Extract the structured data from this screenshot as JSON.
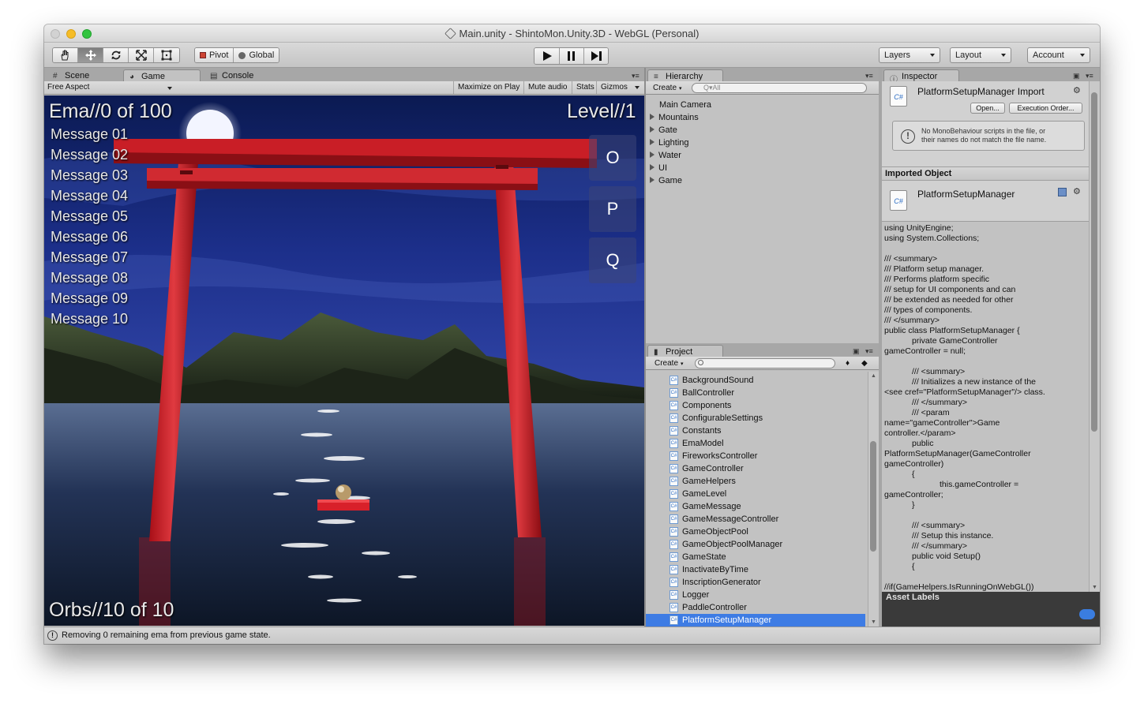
{
  "window": {
    "title": "Main.unity - ShintoMon.Unity.3D - WebGL (Personal)"
  },
  "toolbar": {
    "tools": [
      "hand-icon",
      "move-icon",
      "rotate-icon",
      "scale-icon",
      "rect-icon"
    ],
    "pivot_label": "Pivot",
    "global_label": "Global",
    "layers_label": "Layers",
    "layout_label": "Layout",
    "account_label": "Account"
  },
  "left_panel": {
    "tabs": [
      {
        "label": "Scene",
        "icon": "grid-icon"
      },
      {
        "label": "Game",
        "icon": "pacman-icon"
      },
      {
        "label": "Console",
        "icon": "console-icon"
      }
    ],
    "active_tab": "Game",
    "aspect": "Free Aspect",
    "maximize_label": "Maximize on Play",
    "mute_label": "Mute audio",
    "stats_label": "Stats",
    "gizmos_label": "Gizmos"
  },
  "game": {
    "ema_counter": "Ema//0 of 100",
    "level": "Level//1",
    "orbs": "Orbs//10 of 10",
    "messages": [
      "Message 01",
      "Message 02",
      "Message 03",
      "Message 04",
      "Message 05",
      "Message 06",
      "Message 07",
      "Message 08",
      "Message 09",
      "Message 10"
    ],
    "keys": [
      "O",
      "P",
      "Q"
    ]
  },
  "hierarchy": {
    "tab_label": "Hierarchy",
    "create_label": "Create",
    "search_placeholder": "Q▾All",
    "items": [
      {
        "label": "Main Camera",
        "expandable": false
      },
      {
        "label": "Mountains",
        "expandable": true
      },
      {
        "label": "Gate",
        "expandable": true
      },
      {
        "label": "Lighting",
        "expandable": true
      },
      {
        "label": "Water",
        "expandable": true
      },
      {
        "label": "UI",
        "expandable": true
      },
      {
        "label": "Game",
        "expandable": true
      }
    ]
  },
  "project": {
    "tab_label": "Project",
    "create_label": "Create",
    "items": [
      "BackgroundSound",
      "BallController",
      "Components",
      "ConfigurableSettings",
      "Constants",
      "EmaModel",
      "FireworksController",
      "GameController",
      "GameHelpers",
      "GameLevel",
      "GameMessage",
      "GameMessageController",
      "GameObjectPool",
      "GameObjectPoolManager",
      "GameState",
      "InactivateByTime",
      "InscriptionGenerator",
      "Logger",
      "PaddleController",
      "PlatformSetupManager"
    ],
    "selected": "PlatformSetupManager"
  },
  "inspector": {
    "tab_label": "Inspector",
    "title": "PlatformSetupManager Import",
    "open_label": "Open...",
    "execution_order_label": "Execution Order...",
    "help_text_1": "No MonoBehaviour scripts in the file, or",
    "help_text_2": "their names do not match the file name.",
    "imported_object_label": "Imported Object",
    "object_name": "PlatformSetupManager",
    "code": "using UnityEngine;\nusing System.Collections;\n\n/// <summary>\n/// Platform setup manager.\n/// Performs platform specific\n/// setup for UI components and can\n/// be extended as needed for other\n/// types of components.\n/// </summary>\npublic class PlatformSetupManager {\n            private GameController\ngameController = null;\n\n            /// <summary>\n            /// Initializes a new instance of the\n<see cref=\"PlatformSetupManager\"/> class.\n            /// </summary>\n            /// <param\nname=\"gameController\">Game\ncontroller.</param>\n            public\nPlatformSetupManager(GameController\ngameController)\n            {\n                        this.gameController =\ngameController;\n            }\n\n            /// <summary>\n            /// Setup this instance.\n            /// </summary>\n            public void Setup()\n            {\n\n//if(GameHelpers.IsRunningOnWebGL())",
    "asset_labels": "Asset Labels"
  },
  "status": {
    "text": "Removing 0 remaining ema from previous game state."
  }
}
